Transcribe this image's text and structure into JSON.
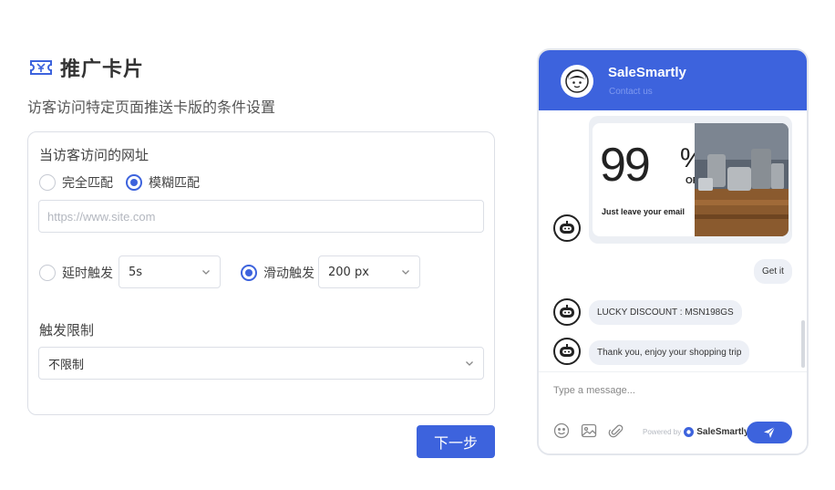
{
  "header": {
    "title": "推广卡片",
    "subtitle": "访客访问特定页面推送卡版的条件设置"
  },
  "url_section": {
    "label": "当访客访问的网址",
    "match_options": [
      {
        "label": "完全匹配",
        "selected": false
      },
      {
        "label": "模糊匹配",
        "selected": true
      }
    ],
    "url_placeholder": "https://www.site.com",
    "url_value": ""
  },
  "trigger": {
    "delay_label": "延时触发",
    "delay_selected": false,
    "delay_value": "5s",
    "scroll_label": "滑动触发",
    "scroll_selected": true,
    "scroll_value": "200 px"
  },
  "limit_section": {
    "label": "触发限制",
    "value": "不限制"
  },
  "next_button": "下一步",
  "widget": {
    "name": "SaleSmartly",
    "subtitle": "Contact us",
    "promo_big": "99",
    "promo_percent": "%",
    "promo_off": "OFF",
    "promo_caption": "Just leave your email",
    "user_bubble": "Get it",
    "messages": [
      "LUCKY DISCOUNT : MSN198GS",
      "Thank you, enjoy your shopping trip"
    ],
    "input_placeholder": "Type a message...",
    "powered_by": "Powered by",
    "powered_brand": "SaleSmartly"
  },
  "colors": {
    "accent": "#3d63dd",
    "border": "#dcdfe6",
    "bubble": "#edf0f6"
  },
  "icons": [
    "ticket-icon",
    "chevron-down-icon",
    "robot-icon",
    "emoji-icon",
    "image-icon",
    "attachment-icon",
    "send-icon",
    "salesmartly-logo-icon"
  ]
}
